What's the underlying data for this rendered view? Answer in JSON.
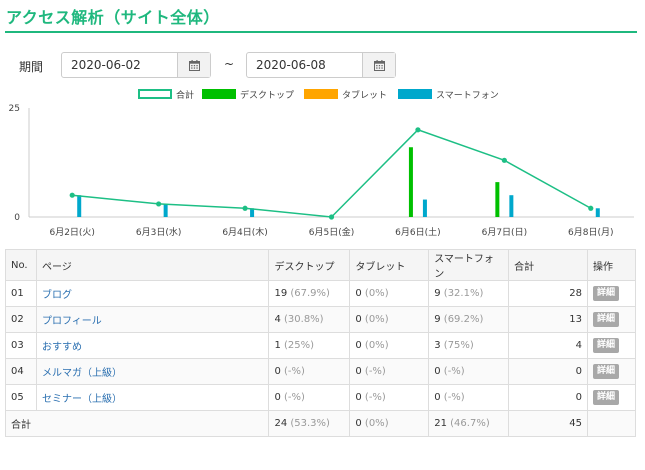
{
  "page": {
    "title": "アクセス解析（サイト全体）"
  },
  "period": {
    "label": "期間",
    "start": "2020-06-02",
    "separator": "~",
    "end": "2020-06-08"
  },
  "colors": {
    "accent": "#1fb87e",
    "total": "#1dbf85",
    "desktop": "#00c000",
    "tablet": "#ffa500",
    "smartphone": "#00a8cc"
  },
  "chart_data": {
    "type": "bar",
    "categories": [
      "6月2日(火)",
      "6月3日(水)",
      "6月4日(木)",
      "6月5日(金)",
      "6月6日(土)",
      "6月7日(日)",
      "6月8日(月)"
    ],
    "series": [
      {
        "name": "合計",
        "type": "line",
        "values": [
          5,
          3,
          2,
          0,
          20,
          13,
          2
        ]
      },
      {
        "name": "デスクトップ",
        "type": "bar",
        "values": [
          0,
          0,
          0,
          0,
          16,
          8,
          0
        ]
      },
      {
        "name": "タブレット",
        "type": "bar",
        "values": [
          0,
          0,
          0,
          0,
          0,
          0,
          0
        ]
      },
      {
        "name": "スマートフォン",
        "type": "bar",
        "values": [
          5,
          3,
          2,
          0,
          4,
          5,
          2
        ]
      }
    ],
    "ylim": [
      0,
      25
    ],
    "yticks": [
      "0",
      "25"
    ],
    "grid": false,
    "legend": "top-center"
  },
  "table": {
    "headers": [
      "No.",
      "ページ",
      "デスクトップ",
      "タブレット",
      "スマートフォン",
      "合計",
      "操作"
    ],
    "rows": [
      {
        "no": "01",
        "page": "ブログ",
        "desktop": "19",
        "desktop_pct": "(67.9%)",
        "tablet": "0",
        "tablet_pct": "(0%)",
        "smart": "9",
        "smart_pct": "(32.1%)",
        "total": "28",
        "action": "詳細"
      },
      {
        "no": "02",
        "page": "プロフィール",
        "desktop": "4",
        "desktop_pct": "(30.8%)",
        "tablet": "0",
        "tablet_pct": "(0%)",
        "smart": "9",
        "smart_pct": "(69.2%)",
        "total": "13",
        "action": "詳細"
      },
      {
        "no": "03",
        "page": "おすすめ",
        "desktop": "1",
        "desktop_pct": "(25%)",
        "tablet": "0",
        "tablet_pct": "(0%)",
        "smart": "3",
        "smart_pct": "(75%)",
        "total": "4",
        "action": "詳細"
      },
      {
        "no": "04",
        "page": "メルマガ（上級）",
        "desktop": "0",
        "desktop_pct": "(-%)",
        "tablet": "0",
        "tablet_pct": "(-%)",
        "smart": "0",
        "smart_pct": "(-%)",
        "total": "0",
        "action": "詳細"
      },
      {
        "no": "05",
        "page": "セミナー（上級）",
        "desktop": "0",
        "desktop_pct": "(-%)",
        "tablet": "0",
        "tablet_pct": "(-%)",
        "smart": "0",
        "smart_pct": "(-%)",
        "total": "0",
        "action": "詳細"
      }
    ],
    "footer": {
      "label": "合計",
      "desktop": "24",
      "desktop_pct": "(53.3%)",
      "tablet": "0",
      "tablet_pct": "(0%)",
      "smart": "21",
      "smart_pct": "(46.7%)",
      "total": "45"
    }
  }
}
